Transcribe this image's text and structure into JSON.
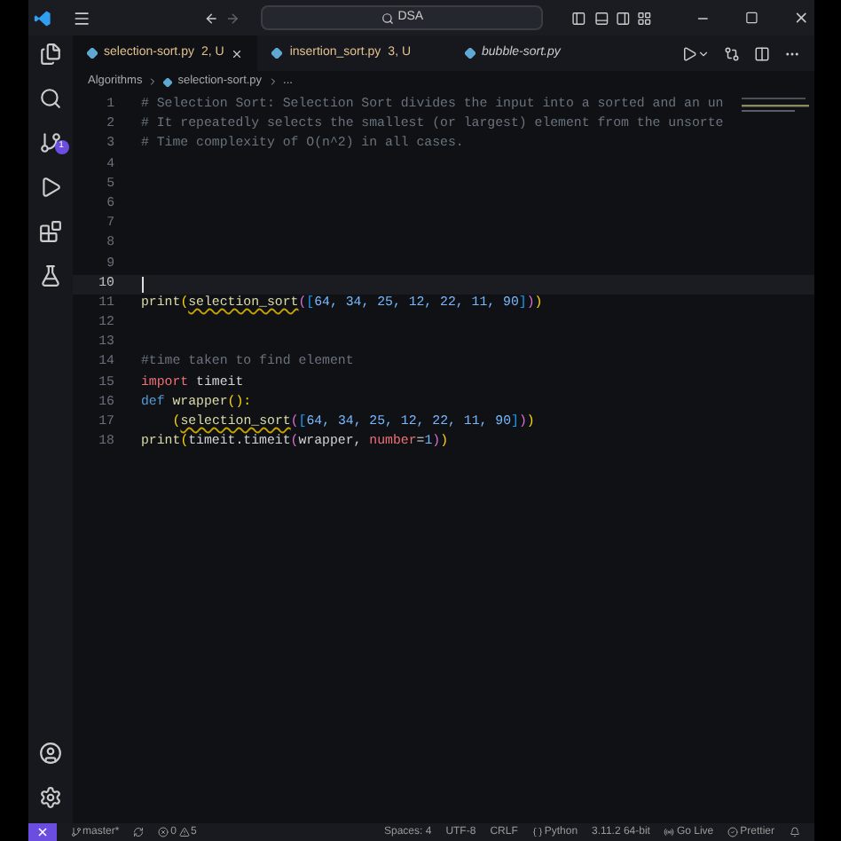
{
  "title_bar": {
    "search": "DSA"
  },
  "activity_bar": {
    "badge": "1"
  },
  "tabs": [
    {
      "label": "selection-sort.py",
      "status": "2, U",
      "selected": true,
      "italic": false
    },
    {
      "label": "insertion_sort.py",
      "status": "3, U",
      "selected": false,
      "italic": false
    },
    {
      "label": "bubble-sort.py",
      "selected": false,
      "italic": true
    }
  ],
  "breadcrumb": [
    "Algorithms",
    "selection-sort.py",
    "..."
  ],
  "editor": {
    "lines": [
      {
        "number": "1",
        "current": false,
        "tokens": [
          {
            "kind": "comment",
            "text": "# Selection Sort: Selection Sort divides the input into a sorted and an un"
          }
        ]
      },
      {
        "number": "2",
        "current": false,
        "tokens": [
          {
            "kind": "comment",
            "text": "# It repeatedly selects the smallest (or largest) element from the unsorte"
          }
        ]
      },
      {
        "number": "3",
        "current": false,
        "tokens": [
          {
            "kind": "comment",
            "text": "# Time complexity of O(n^2) in all cases."
          }
        ]
      },
      {
        "number": "4",
        "current": false
      },
      {
        "number": "5",
        "current": false
      },
      {
        "number": "6",
        "current": false
      },
      {
        "number": "7",
        "current": false
      },
      {
        "number": "8",
        "current": false
      },
      {
        "number": "9",
        "current": false
      },
      {
        "number": "10",
        "current": true
      },
      {
        "number": "11",
        "current": false,
        "tokens": [
          {
            "kind": "func",
            "text": "print"
          },
          {
            "kind": "bracket",
            "text": "("
          },
          {
            "kind": "func",
            "text": "selection_sort",
            "warning": true
          },
          {
            "kind": "bracket2",
            "text": "("
          },
          {
            "kind": "bracket3",
            "text": "["
          },
          {
            "kind": "number",
            "text": "64, 34, 25, 12, 22, 11, 90"
          },
          {
            "kind": "bracket3",
            "text": "]"
          },
          {
            "kind": "bracket2",
            "text": ")"
          },
          {
            "kind": "bracket",
            "text": ")"
          }
        ]
      },
      {
        "number": "12",
        "current": false
      },
      {
        "number": "13",
        "current": false
      },
      {
        "number": "14",
        "current": false,
        "tokens": [
          {
            "kind": "comment",
            "text": "#time taken to find element"
          }
        ]
      },
      {
        "number": "15",
        "current": false,
        "tokens": [
          {
            "kind": "keyword",
            "text": "import"
          },
          {
            "kind": "plain",
            "text": " timeit"
          }
        ]
      },
      {
        "number": "16",
        "current": false,
        "tokens": [
          {
            "kind": "def",
            "text": "def"
          },
          {
            "kind": "func",
            "text": " wrapper"
          },
          {
            "kind": "bracket",
            "text": "():"
          }
        ]
      },
      {
        "number": "17",
        "current": false,
        "indent": true,
        "tokens": [
          {
            "kind": "bracket",
            "text": "("
          },
          {
            "kind": "func",
            "text": "selection_sort",
            "warning": true
          },
          {
            "kind": "bracket2",
            "text": "("
          },
          {
            "kind": "bracket3",
            "text": "["
          },
          {
            "kind": "number",
            "text": "64, 34, 25, 12, 22, 11, 90"
          },
          {
            "kind": "bracket3",
            "text": "]"
          },
          {
            "kind": "bracket2",
            "text": ")"
          },
          {
            "kind": "bracket",
            "text": ")"
          }
        ]
      },
      {
        "number": "18",
        "current": false,
        "tokens": [
          {
            "kind": "func",
            "text": "print"
          },
          {
            "kind": "bracket",
            "text": "("
          },
          {
            "kind": "plain",
            "text": "timeit.timeit"
          },
          {
            "kind": "bracket2",
            "text": "("
          },
          {
            "kind": "plain",
            "text": "wrapper, "
          },
          {
            "kind": "param",
            "text": "number"
          },
          {
            "kind": "plain",
            "text": "="
          },
          {
            "kind": "number",
            "text": "1"
          },
          {
            "kind": "bracket2",
            "text": ")"
          },
          {
            "kind": "bracket",
            "text": ")"
          }
        ]
      }
    ]
  },
  "status_bar": {
    "branch": "master*",
    "errors": "0",
    "warnings": "5",
    "items": [
      "Spaces: 4",
      "UTF-8",
      "CRLF",
      "Python",
      "3.11.2 64-bit",
      "Go Live",
      "Prettier"
    ]
  }
}
